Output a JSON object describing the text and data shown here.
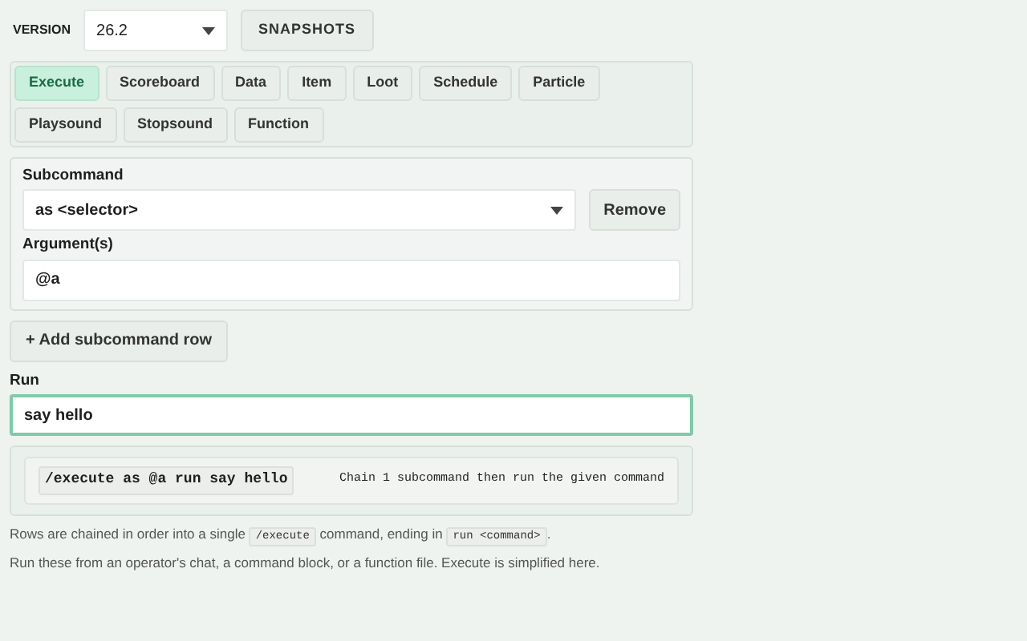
{
  "version": {
    "label": "VERSION",
    "value": "26.2"
  },
  "snapshots_button": "SNAPSHOTS",
  "tabs": [
    {
      "label": "Execute",
      "selected": true
    },
    {
      "label": "Scoreboard",
      "selected": false
    },
    {
      "label": "Data",
      "selected": false
    },
    {
      "label": "Item",
      "selected": false
    },
    {
      "label": "Loot",
      "selected": false
    },
    {
      "label": "Schedule",
      "selected": false
    },
    {
      "label": "Particle",
      "selected": false
    },
    {
      "label": "Playsound",
      "selected": false
    },
    {
      "label": "Stopsound",
      "selected": false
    },
    {
      "label": "Function",
      "selected": false
    }
  ],
  "subcommand_rows": [
    {
      "subcommand_label": "Subcommand",
      "subcommand": "as <selector>",
      "remove_button": "Remove",
      "arguments_label": "Argument(s)",
      "arguments": "@a"
    }
  ],
  "add_row_button": "+ Add subcommand row",
  "run": {
    "label": "Run",
    "value": "say hello"
  },
  "output": {
    "command": "/execute as @a run say hello",
    "summary": "Chain 1 subcommand then run the given command"
  },
  "notes": [
    {
      "parts": [
        {
          "kind": "text",
          "text": "Rows are chained in order into a single "
        },
        {
          "kind": "code",
          "text": "/execute"
        },
        {
          "kind": "text",
          "text": " command, ending in "
        },
        {
          "kind": "code",
          "text": "run <command>"
        },
        {
          "kind": "text",
          "text": "."
        }
      ]
    },
    {
      "parts": [
        {
          "kind": "text",
          "text": "Run these from an operator's chat, a command block, or a function file. Execute is simplified here."
        }
      ]
    }
  ]
}
